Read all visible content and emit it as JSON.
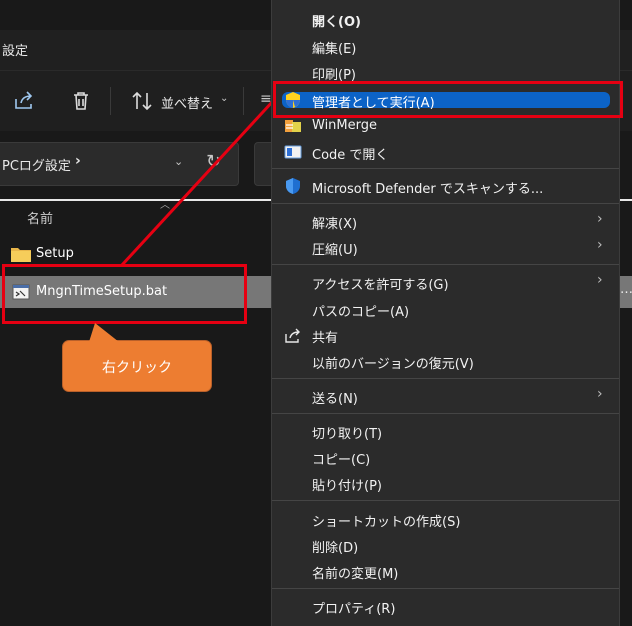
{
  "window": {
    "title": "設定"
  },
  "toolbar": {
    "share_icon": "share-icon",
    "delete_icon": "trash-icon",
    "sort_label": "並べ替え",
    "more": "≡"
  },
  "address": {
    "path": "PCログ設定",
    "separator": "›"
  },
  "list": {
    "column_name": "名前",
    "items": [
      {
        "name": "Setup",
        "icon": "folder-icon"
      },
      {
        "name": "MngnTimeSetup.bat",
        "icon": "batch-file-icon",
        "selected": true
      }
    ]
  },
  "callout": {
    "text": "右クリック"
  },
  "context_menu": {
    "items": [
      {
        "label": "開く(O)"
      },
      {
        "label": "編集(E)"
      },
      {
        "label": "印刷(P)"
      },
      {
        "label": "管理者として実行(A)",
        "icon": "uac-shield-icon",
        "highlighted": true
      },
      {
        "label": "WinMerge",
        "icon": "winmerge-icon"
      },
      {
        "label": "Code で開く",
        "icon": "vscode-icon"
      },
      {
        "label": "Microsoft Defender でスキャンする...",
        "icon": "defender-shield-icon"
      },
      {
        "label": "解凍(X)",
        "submenu": true
      },
      {
        "label": "圧縮(U)",
        "submenu": true
      },
      {
        "label": "アクセスを許可する(G)",
        "submenu": true
      },
      {
        "label": "パスのコピー(A)"
      },
      {
        "label": "共有",
        "icon": "share-icon"
      },
      {
        "label": "以前のバージョンの復元(V)"
      },
      {
        "label": "送る(N)",
        "submenu": true
      },
      {
        "label": "切り取り(T)"
      },
      {
        "label": "コピー(C)"
      },
      {
        "label": "貼り付け(P)"
      },
      {
        "label": "ショートカットの作成(S)"
      },
      {
        "label": "削除(D)"
      },
      {
        "label": "名前の変更(M)"
      },
      {
        "label": "プロパティ(R)"
      }
    ],
    "submenu_glyph": "›"
  },
  "colors": {
    "highlight": "#0c63c7",
    "annotation_red": "#e60012",
    "callout_orange": "#ed7d31"
  }
}
